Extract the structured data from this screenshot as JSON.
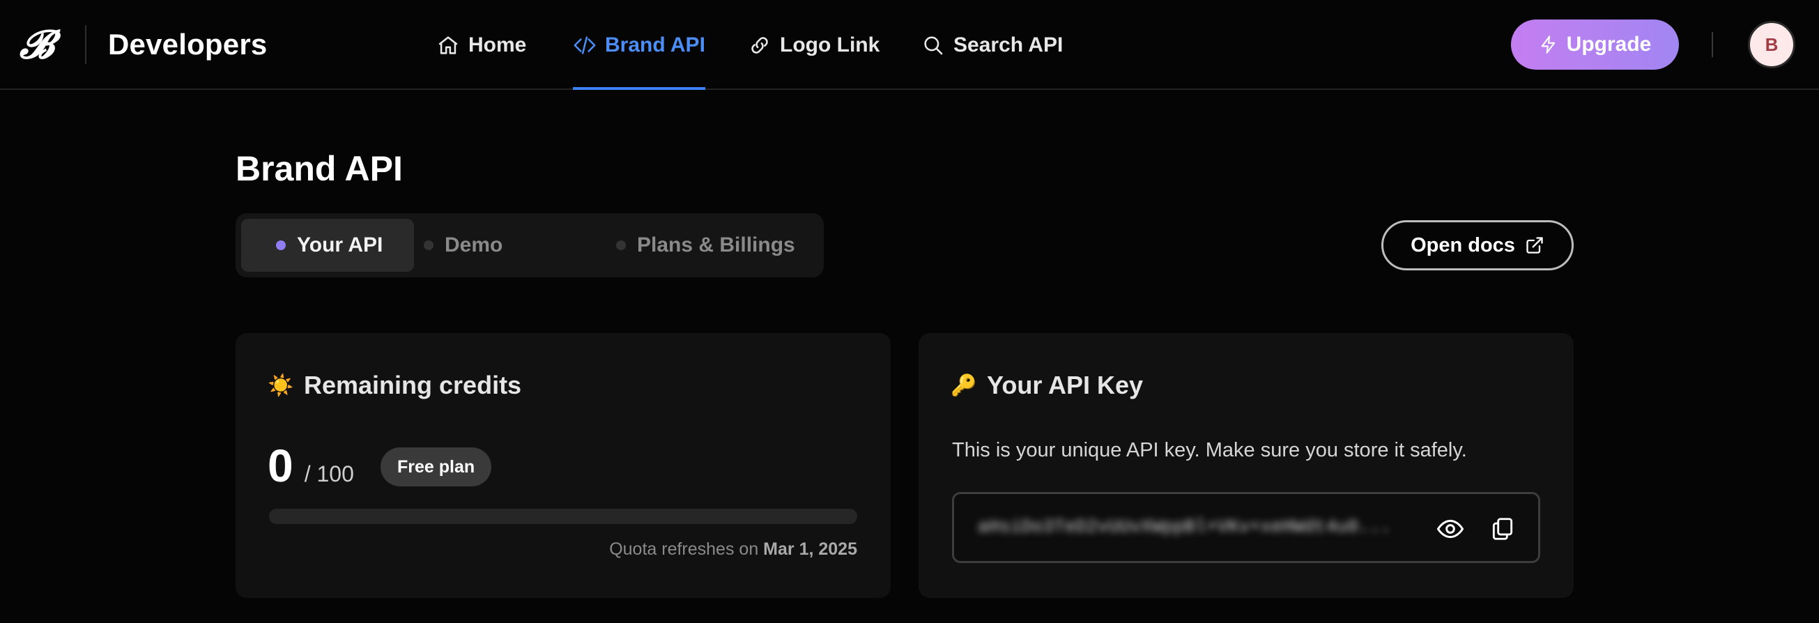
{
  "header": {
    "brand_title": "Developers",
    "nav": [
      {
        "label": "Home",
        "icon": "home-icon"
      },
      {
        "label": "Brand API",
        "icon": "code-icon",
        "active": true
      },
      {
        "label": "Logo Link",
        "icon": "link-icon"
      },
      {
        "label": "Search API",
        "icon": "search-icon"
      }
    ],
    "upgrade_label": "Upgrade",
    "avatar_initial": "B"
  },
  "page": {
    "title": "Brand API",
    "tabs": [
      {
        "label": "Your API",
        "active": true
      },
      {
        "label": "Demo"
      },
      {
        "label": "Plans & Billings"
      }
    ],
    "open_docs_label": "Open docs"
  },
  "credits_card": {
    "icon": "☀️",
    "title": "Remaining credits",
    "remaining": "0",
    "total": "/ 100",
    "plan_badge": "Free plan",
    "progress_fraction": 0,
    "refresh_prefix": "Quota refreshes on",
    "refresh_date": "Mar 1, 2025"
  },
  "api_key_card": {
    "icon": "🔑",
    "title": "Your API Key",
    "description": "This is your unique API key. Make sure you store it safely.",
    "key_masked": "aHsiDo3TeD2vUUvXWppBl+VKv+xeHWdt4u0..."
  },
  "colors": {
    "accent_blue": "#3d82f5",
    "accent_purple": "#8f7ef0",
    "upgrade_gradient_start": "#c47ef0",
    "upgrade_gradient_end": "#a186f2"
  }
}
